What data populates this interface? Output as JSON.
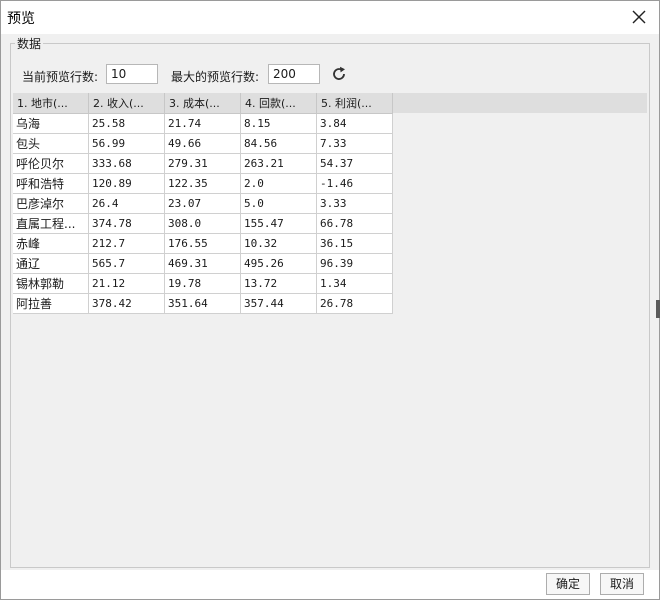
{
  "window": {
    "title": "预览"
  },
  "group": {
    "label": "数据"
  },
  "controls": {
    "current_rows_label": "当前预览行数:",
    "current_rows_value": "10",
    "max_rows_label": "最大的预览行数:",
    "max_rows_value": "200",
    "refresh_icon": "refresh-icon"
  },
  "table": {
    "columns": [
      "1. 地市(...",
      "2. 收入(...",
      "3. 成本(...",
      "4. 回款(...",
      "5. 利润(..."
    ],
    "rows": [
      [
        "乌海",
        "25.58",
        "21.74",
        "8.15",
        "3.84"
      ],
      [
        "包头",
        "56.99",
        "49.66",
        "84.56",
        "7.33"
      ],
      [
        "呼伦贝尔",
        "333.68",
        "279.31",
        "263.21",
        "54.37"
      ],
      [
        "呼和浩特",
        "120.89",
        "122.35",
        "2.0",
        "-1.46"
      ],
      [
        "巴彦淖尔",
        "26.4",
        "23.07",
        "5.0",
        "3.33"
      ],
      [
        "直属工程...",
        "374.78",
        "308.0",
        "155.47",
        "66.78"
      ],
      [
        "赤峰",
        "212.7",
        "176.55",
        "10.32",
        "36.15"
      ],
      [
        "通辽",
        "565.7",
        "469.31",
        "495.26",
        "96.39"
      ],
      [
        "锡林郭勒",
        "21.12",
        "19.78",
        "13.72",
        "1.34"
      ],
      [
        "阿拉善",
        "378.42",
        "351.64",
        "357.44",
        "26.78"
      ]
    ]
  },
  "buttons": {
    "ok": "确定",
    "cancel": "取消"
  }
}
